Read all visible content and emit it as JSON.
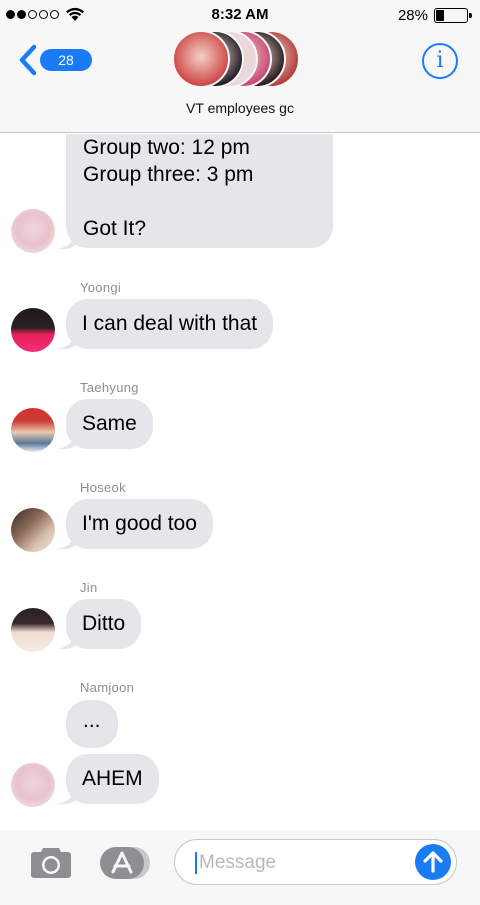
{
  "status_bar": {
    "signal_dots": [
      true,
      true,
      false,
      false,
      false
    ],
    "time": "8:32 AM",
    "battery_percent": "28%",
    "battery_level": 0.28
  },
  "header": {
    "back_badge": "28",
    "group_name": "VT employees gc",
    "info_icon": "info-icon",
    "stack_colors": [
      "#d04a4a",
      "#232028",
      "#e8d8e0",
      "#c94a78",
      "#2a1e22",
      "#b04040"
    ]
  },
  "messages": {
    "first": {
      "lines": [
        "Group two: 12 pm",
        "Group three: 3 pm",
        "",
        "Got It?"
      ]
    },
    "yoongi": {
      "sender": "Yoongi",
      "text": "I can deal with that"
    },
    "taehyung": {
      "sender": "Taehyung",
      "text": "Same"
    },
    "hoseok": {
      "sender": "Hoseok",
      "text": "I'm good too"
    },
    "jin": {
      "sender": "Jin",
      "text": "Ditto"
    },
    "namjoon": {
      "sender": "Namjoon",
      "text1": "...",
      "text2": "AHEM"
    }
  },
  "input_bar": {
    "placeholder": "Message",
    "camera_icon": "camera-icon",
    "appstore_icon": "app-store-icon",
    "send_icon": "arrow-up-icon"
  },
  "colors": {
    "accent": "#1a7cf4",
    "bubble": "#e5e5ea",
    "sender_label": "#8e8e93"
  }
}
